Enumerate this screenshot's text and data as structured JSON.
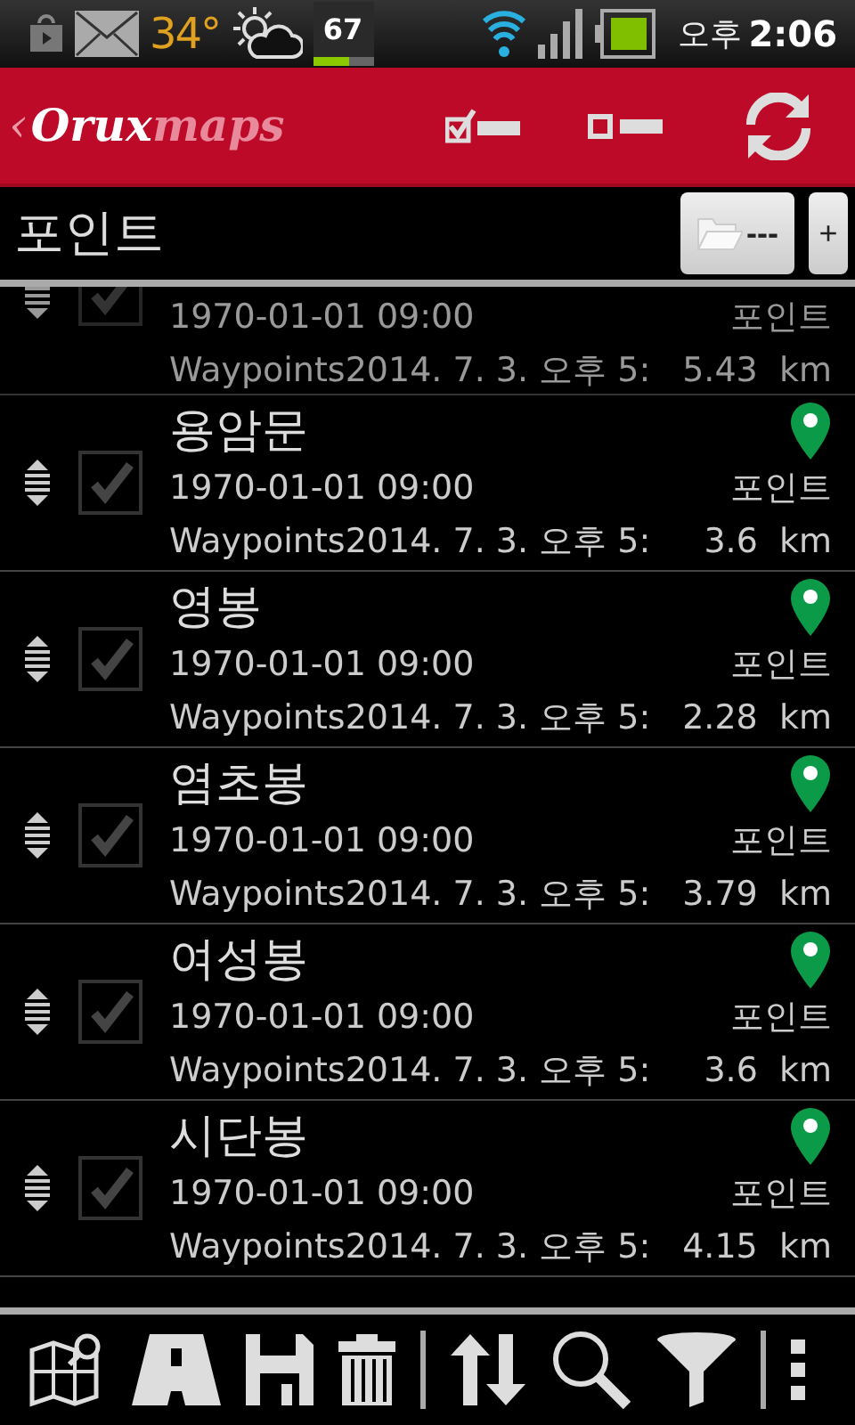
{
  "status_bar": {
    "temperature": "34°",
    "battery_widget": "67",
    "level": 0.6,
    "time_period": "오후",
    "time": "2:06"
  },
  "app_bar": {
    "back": "‹",
    "logo_bold": "Orux",
    "logo_light": "maps"
  },
  "header": {
    "title": "포인트",
    "folder_button": "---",
    "add_button": "+"
  },
  "points": [
    {
      "checked": true,
      "date": "1970-01-01 09:00",
      "type": "포인트",
      "folder": "Waypoints2014. 7. 3. 오후 5:",
      "distance": "5.43  km"
    },
    {
      "checked": true,
      "name": "용암문",
      "date": "1970-01-01 09:00",
      "type": "포인트",
      "folder": "Waypoints2014. 7. 3. 오후 5:",
      "distance": "3.6  km"
    },
    {
      "checked": true,
      "name": "영봉",
      "date": "1970-01-01 09:00",
      "type": "포인트",
      "folder": "Waypoints2014. 7. 3. 오후 5:",
      "distance": "2.28  km"
    },
    {
      "checked": true,
      "name": "염초봉",
      "date": "1970-01-01 09:00",
      "type": "포인트",
      "folder": "Waypoints2014. 7. 3. 오후 5:",
      "distance": "3.79  km"
    },
    {
      "checked": true,
      "name": "여성봉",
      "date": "1970-01-01 09:00",
      "type": "포인트",
      "folder": "Waypoints2014. 7. 3. 오후 5:",
      "distance": "3.6  km"
    },
    {
      "checked": true,
      "name": "시단봉",
      "date": "1970-01-01 09:00",
      "type": "포인트",
      "folder": "Waypoints2014. 7. 3. 오후 5:",
      "distance": "4.15  km"
    }
  ]
}
